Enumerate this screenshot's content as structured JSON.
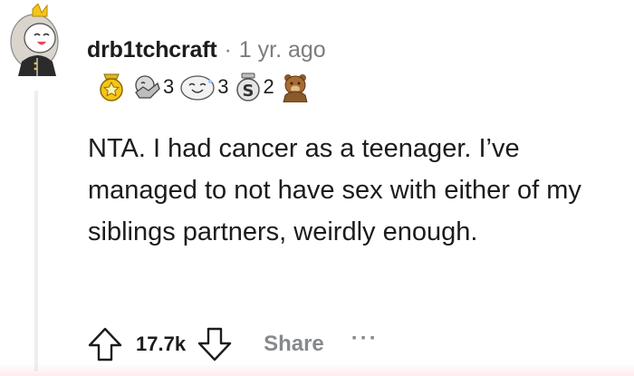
{
  "comment": {
    "author": "drb1tchcraft",
    "separator": "·",
    "timestamp": "1 yr. ago",
    "body": "NTA. I had cancer as a teenager. I’ve managed to not have sex with either of my siblings partners, weirdly enough."
  },
  "awards": [
    {
      "icon": "gold-star-award-icon",
      "count": ""
    },
    {
      "icon": "wholesome-hug-award-icon",
      "count": "3"
    },
    {
      "icon": "laughing-face-award-icon",
      "count": "3"
    },
    {
      "icon": "silver-s-award-icon",
      "count": "2"
    },
    {
      "icon": "bear-award-icon",
      "count": ""
    }
  ],
  "actions": {
    "upvote_icon": "upvote-arrow-icon",
    "score": "17.7k",
    "downvote_icon": "downvote-arrow-icon",
    "share_label": "Share",
    "more_label": "···"
  },
  "colors": {
    "text": "#1c1c1c",
    "muted": "#7c7c7c",
    "action_gray": "#878a8c",
    "thread_line": "#edeff1"
  }
}
